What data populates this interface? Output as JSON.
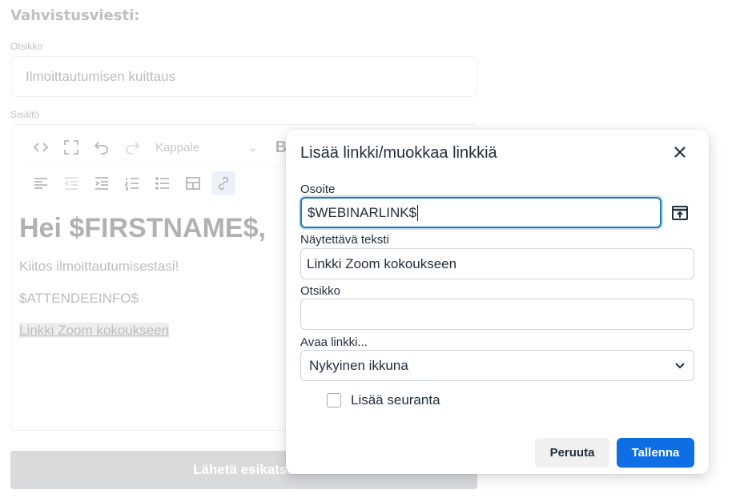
{
  "background": {
    "section_title": "Vahvistusviesti:",
    "subject_label": "Otsikko",
    "subject_value": "Ilmoittautumisen kuittaus",
    "content_label": "Sisältö",
    "toolbar": {
      "block_format": "Kappale",
      "bold_label": "B"
    },
    "editor": {
      "heading": "Hei $FIRSTNAME$,",
      "paragraph1": "Kiitos ilmoittautumisestasi!",
      "paragraph2": "$ATTENDEEINFO$",
      "link_text": "Linkki Zoom kokoukseen"
    },
    "preview_button": "Lähetä esikatse"
  },
  "dialog": {
    "title": "Lisää linkki/muokkaa linkkiä",
    "url_label": "Osoite",
    "url_value": "$WEBINARLINK$",
    "text_label": "Näytettävä teksti",
    "text_value": "Linkki Zoom kokoukseen",
    "title_label": "Otsikko",
    "title_value": "",
    "target_label": "Avaa linkki...",
    "target_value": "Nykyinen ikkuna",
    "tracking_label": "Lisää seuranta",
    "tracking_checked": false,
    "cancel_label": "Peruuta",
    "save_label": "Tallenna"
  },
  "colors": {
    "primary": "#0d6ee6",
    "focus_border": "#207ab7",
    "text": "#222f3e"
  },
  "icons": [
    "code-icon",
    "fullscreen-icon",
    "undo-icon",
    "redo-icon",
    "chevron-down-icon",
    "align-left-icon",
    "outdent-icon",
    "indent-icon",
    "numbered-list-icon",
    "bullet-list-icon",
    "table-icon",
    "link-icon",
    "close-icon",
    "browse-icon"
  ]
}
